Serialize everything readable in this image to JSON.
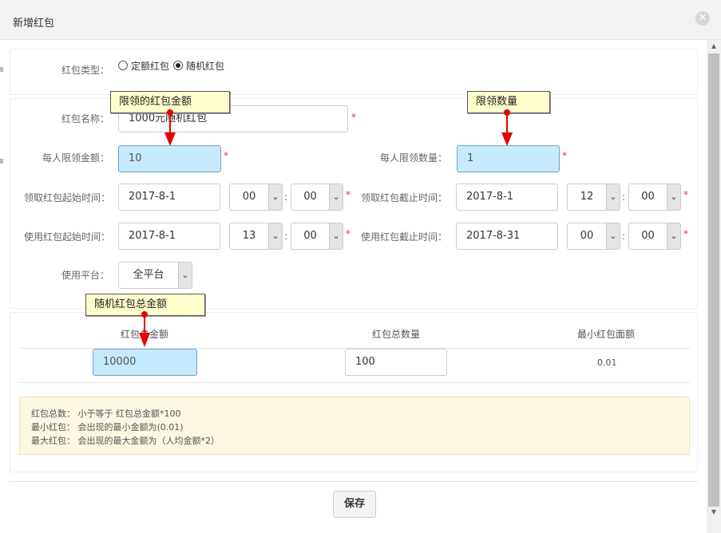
{
  "dialog": {
    "title": "新增红包",
    "close_symbol": "✕"
  },
  "type_row": {
    "label": "红包类型：",
    "options": [
      {
        "label": "定额红包",
        "selected": false
      },
      {
        "label": "随机红包",
        "selected": true
      }
    ]
  },
  "form": {
    "required_mark": "*",
    "name": {
      "label": "红包名称：",
      "value": "1000元随机红包"
    },
    "per_amount": {
      "label": "每人限领金额：",
      "value": "10"
    },
    "per_count": {
      "label": "每人限领数量：",
      "value": "1"
    },
    "claim_start": {
      "label": "领取红包起始时间：",
      "date": "2017-8-1",
      "hour": "00",
      "minute": "00"
    },
    "claim_end": {
      "label": "领取红包截止时间：",
      "date": "2017-8-1",
      "hour": "12",
      "minute": "00"
    },
    "use_start": {
      "label": "使用红包起始时间：",
      "date": "2017-8-1",
      "hour": "13",
      "minute": "00"
    },
    "use_end": {
      "label": "使用红包截止时间：",
      "date": "2017-8-31",
      "hour": "00",
      "minute": "00"
    },
    "platform": {
      "label": "使用平台：",
      "value": "全平台"
    },
    "time_colon": ":",
    "dropdown_arrow": "⌄"
  },
  "annotations": {
    "amount": "限领的红包金额",
    "count": "限领数量",
    "total": "随机红包总金额"
  },
  "totals_table": {
    "headers": [
      "红包总金额",
      "红包总数量",
      "最小红包面额"
    ],
    "total_amount": "10000",
    "total_count": "100",
    "min_value": "0.01"
  },
  "notes": [
    "红包总数： 小于等于 红包总金额*100",
    "最小红包： 会出现的最小金额为(0.01)",
    "最大红包： 会出现的最大金额为（人均金额*2）"
  ],
  "footer": {
    "save_label": "保存"
  },
  "colors": {
    "highlight_input": "#c5e9fd",
    "tooltip": "#ffffcc",
    "pointer": "#e60000",
    "required": "#e33333",
    "note_bg": "#fcf8e3"
  }
}
